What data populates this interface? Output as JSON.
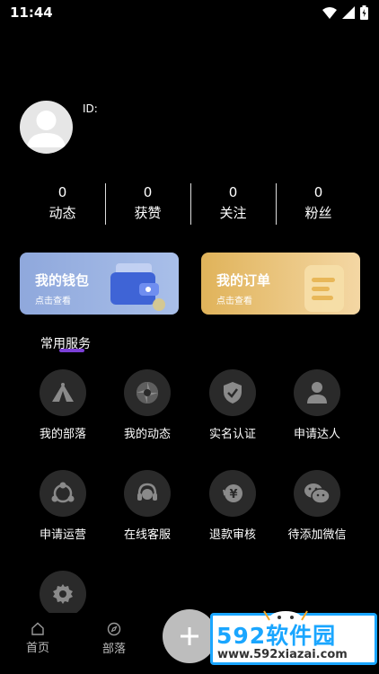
{
  "status_bar": {
    "time": "11:44"
  },
  "profile": {
    "id_label": "ID:"
  },
  "stats": [
    {
      "value": "0",
      "label": "动态"
    },
    {
      "value": "0",
      "label": "获赞"
    },
    {
      "value": "0",
      "label": "关注"
    },
    {
      "value": "0",
      "label": "粉丝"
    }
  ],
  "cards": {
    "wallet": {
      "title": "我的钱包",
      "subtitle": "点击查看"
    },
    "orders": {
      "title": "我的订单",
      "subtitle": "点击查看"
    }
  },
  "services": {
    "title": "常用服务",
    "items": [
      {
        "label": "我的部落",
        "icon": "tent-icon"
      },
      {
        "label": "我的动态",
        "icon": "aperture-icon"
      },
      {
        "label": "实名认证",
        "icon": "shield-check-icon"
      },
      {
        "label": "申请达人",
        "icon": "person-icon"
      },
      {
        "label": "申请运营",
        "icon": "network-icon"
      },
      {
        "label": "在线客服",
        "icon": "headset-icon"
      },
      {
        "label": "退款审核",
        "icon": "yen-refund-icon"
      },
      {
        "label": "待添加微信",
        "icon": "wechat-icon"
      },
      {
        "label": "",
        "icon": "settings-icon"
      }
    ]
  },
  "bottom_nav": {
    "items": [
      {
        "label": "首页",
        "icon": "home-icon"
      },
      {
        "label": "部落",
        "icon": "compass-icon"
      }
    ],
    "fab_icon": "plus-icon"
  },
  "watermark": {
    "logo": "592软件园",
    "url": "www.592xiazai.com"
  },
  "colors": {
    "background": "#000000",
    "icon_circle": "#2a2a2a",
    "wallet_card": "#9ab2e2",
    "orders_card": "#e8c27a",
    "accent_mark": "#7b3fd6",
    "watermark_blue": "#1aa6ff"
  }
}
